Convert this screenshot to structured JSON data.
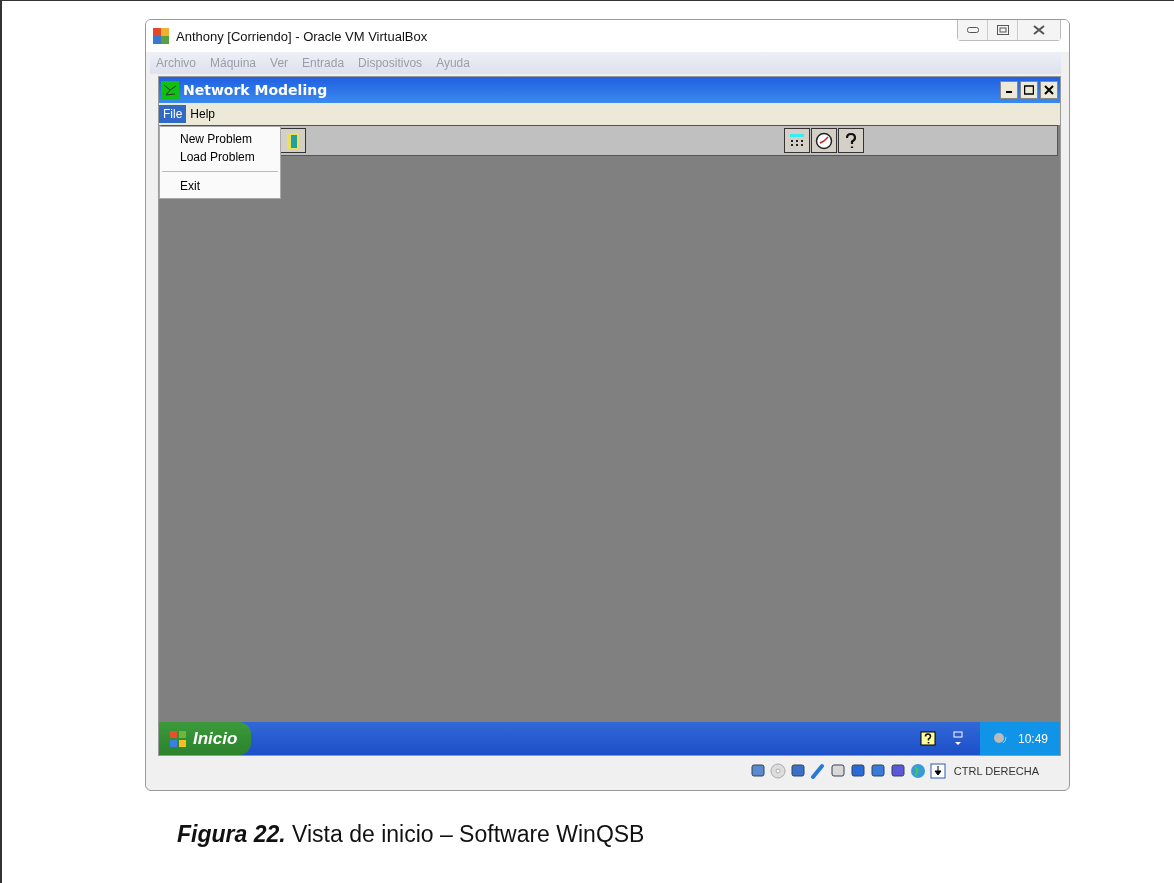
{
  "window": {
    "title": "Anthony [Corriendo] - Oracle VM VirtualBox"
  },
  "vbox_menu": [
    {
      "label": "Archivo",
      "disabled": true
    },
    {
      "label": "Máquina",
      "disabled": true
    },
    {
      "label": "Ver",
      "disabled": true
    },
    {
      "label": "Entrada",
      "disabled": true
    },
    {
      "label": "Dispositivos",
      "disabled": true
    },
    {
      "label": "Ayuda",
      "disabled": true
    }
  ],
  "app": {
    "title": "Network Modeling",
    "menu": [
      {
        "label": "File",
        "selected": true
      },
      {
        "label": "Help",
        "selected": false
      }
    ],
    "file_menu": [
      {
        "kind": "item",
        "label": "New Problem"
      },
      {
        "kind": "item",
        "label": "Load Problem"
      },
      {
        "kind": "separator"
      },
      {
        "kind": "item",
        "label": "Exit"
      }
    ]
  },
  "taskbar": {
    "start": "Inicio",
    "clock": "10:49"
  },
  "status_bar": {
    "host_key": "CTRL DERECHA"
  },
  "caption": "**Figura 22.** Vista de inicio – Software WinQSB"
}
